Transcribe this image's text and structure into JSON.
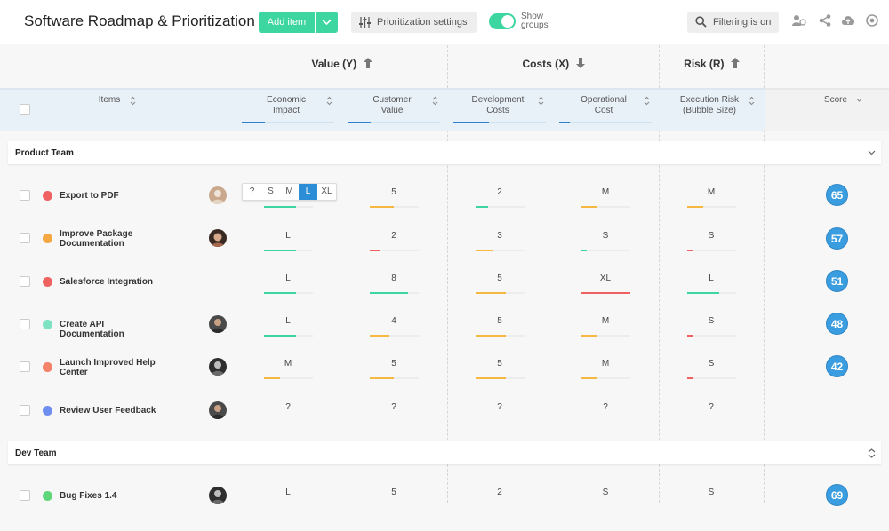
{
  "app": {
    "title": "Software Roadmap & Prioritization",
    "add_item": "Add item",
    "prio_settings": "Prioritization settings",
    "show_groups": "Show groups",
    "filtering": "Filtering is on"
  },
  "groups_hdr": {
    "value": "Value (Y)",
    "costs": "Costs (X)",
    "risk": "Risk (R)"
  },
  "columns": {
    "items": "Items",
    "economic": "Economic Impact",
    "customer": "Customer Value",
    "dev": "Development Costs",
    "oper": "Operational Cost",
    "risk": "Execution Risk (Bubble Size)",
    "score": "Score"
  },
  "size_selector": {
    "options": [
      "?",
      "S",
      "M",
      "L",
      "XL"
    ],
    "selected": "L"
  },
  "team_groups": [
    {
      "name": "Product Team"
    },
    {
      "name": "Dev Team"
    }
  ],
  "rows": [
    {
      "name": "Export to PDF",
      "dot": "#f06262",
      "economic": "",
      "customer": "5",
      "dev": "2",
      "oper": "M",
      "risk": "M",
      "score": "65"
    },
    {
      "name": "Improve Package Documentation",
      "dot": "#f5a742",
      "economic": "L",
      "customer": "2",
      "dev": "3",
      "oper": "S",
      "risk": "S",
      "score": "57"
    },
    {
      "name": "Salesforce Integration",
      "dot": "#f06262",
      "economic": "L",
      "customer": "8",
      "dev": "5",
      "oper": "XL",
      "risk": "L",
      "score": "51"
    },
    {
      "name": "Create API Documentation",
      "dot": "#7de3c2",
      "economic": "L",
      "customer": "4",
      "dev": "5",
      "oper": "M",
      "risk": "S",
      "score": "48"
    },
    {
      "name": "Launch Improved Help Center",
      "dot": "#f5826a",
      "economic": "M",
      "customer": "5",
      "dev": "5",
      "oper": "M",
      "risk": "S",
      "score": "42"
    },
    {
      "name": "Review User Feedback",
      "dot": "#6f8ff0",
      "economic": "?",
      "customer": "?",
      "dev": "?",
      "oper": "?",
      "risk": "?",
      "score": ""
    },
    {
      "name": "Bug Fixes 1.4",
      "dot": "#5fd67a",
      "economic": "L",
      "customer": "5",
      "dev": "2",
      "oper": "S",
      "risk": "S",
      "score": "69"
    }
  ]
}
